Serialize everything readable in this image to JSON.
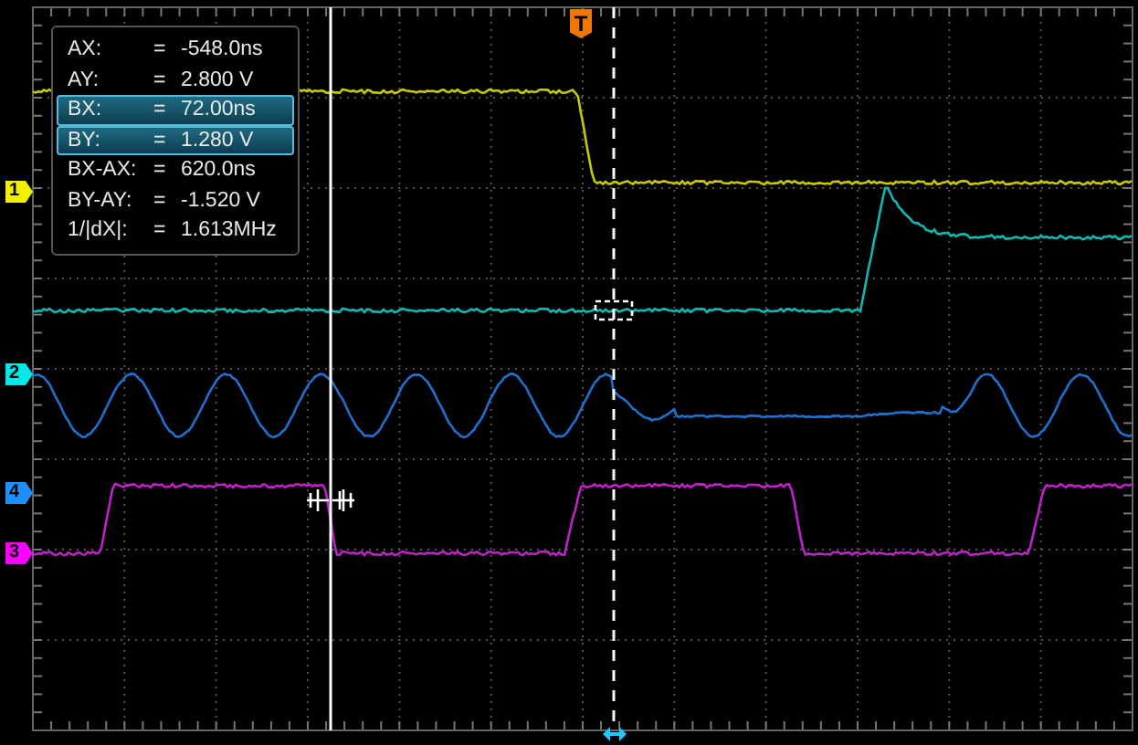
{
  "trigger_marker": {
    "label": "T"
  },
  "channel_markers": [
    {
      "label": "1",
      "color": "#f0f000"
    },
    {
      "label": "2",
      "color": "#00e8e8"
    },
    {
      "label": "4",
      "color": "#1e8fff"
    },
    {
      "label": "3",
      "color": "#ff00ff"
    }
  ],
  "readout": {
    "rows": [
      {
        "label": "AX:",
        "equals": "=",
        "value": "-548.0ns",
        "selected": false
      },
      {
        "label": "AY:",
        "equals": "=",
        "value": "2.800 V",
        "selected": false
      },
      {
        "label": "BX:",
        "equals": "=",
        "value": "72.00ns",
        "selected": true
      },
      {
        "label": "BY:",
        "equals": "=",
        "value": "1.280 V",
        "selected": true
      },
      {
        "label": "BX-AX:",
        "equals": "=",
        "value": "620.0ns",
        "selected": false
      },
      {
        "label": "BY-AY:",
        "equals": "=",
        "value": "-1.520 V",
        "selected": false
      },
      {
        "label": "1/|dX|:",
        "equals": "=",
        "value": "1.613MHz",
        "selected": false
      }
    ]
  }
}
